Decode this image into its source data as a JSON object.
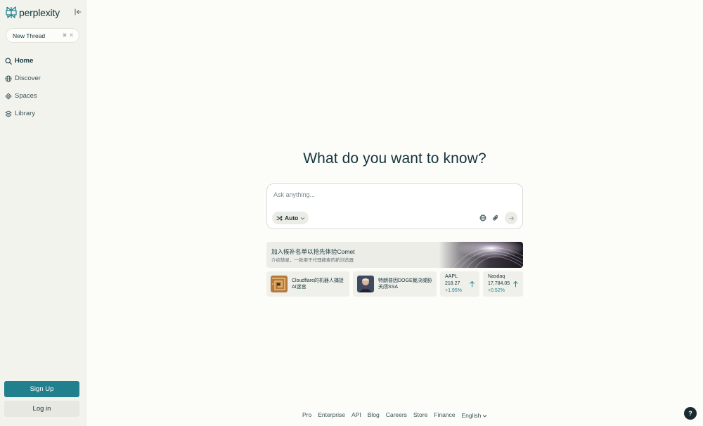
{
  "sidebar": {
    "logo_text": "perplexity",
    "new_thread": {
      "label": "New Thread",
      "shortcut": [
        "⌘",
        "K"
      ]
    },
    "nav": [
      {
        "label": "Home",
        "icon": "search-icon",
        "active": true
      },
      {
        "label": "Discover",
        "icon": "globe-icon",
        "active": false
      },
      {
        "label": "Spaces",
        "icon": "spaces-icon",
        "active": false
      },
      {
        "label": "Library",
        "icon": "library-icon",
        "active": false
      }
    ],
    "signup_label": "Sign Up",
    "login_label": "Log in"
  },
  "main": {
    "headline": "What do you want to know?",
    "search": {
      "placeholder": "Ask anything...",
      "mode_label": "Auto"
    },
    "banner": {
      "title": "加入候补名单以抢先体验Comet",
      "subtitle": "介绍彗星，一款用于代理搜索的新浏览器"
    },
    "news_cards": [
      {
        "text": "Cloudflare的机器人捕捉AI迷宫"
      },
      {
        "text": "特朗普因DOGE裁决威胁关闭SSA"
      }
    ],
    "stocks": [
      {
        "symbol": "AAPL",
        "price": "218.27",
        "change": "+1.95%"
      },
      {
        "symbol": "Nasdaq",
        "price": "17,784.05",
        "change": "+0.52%"
      }
    ]
  },
  "footer": {
    "links": [
      "Pro",
      "Enterprise",
      "API",
      "Blog",
      "Careers",
      "Store",
      "Finance"
    ],
    "language": "English"
  },
  "help_label": "?",
  "colors": {
    "accent": "#21808d",
    "text": "#13343b",
    "sidebar_bg": "#f3f3ee",
    "page_bg": "#fcfcf9"
  }
}
